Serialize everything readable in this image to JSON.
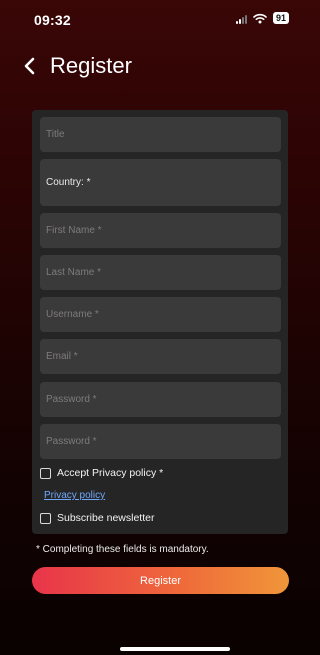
{
  "status": {
    "time": "09:32",
    "battery": "91"
  },
  "header": {
    "title": "Register"
  },
  "form": {
    "title_placeholder": "Title",
    "country_label": "Country: *",
    "first_name_placeholder": "First Name *",
    "last_name_placeholder": "Last Name *",
    "username_placeholder": "Username *",
    "email_placeholder": "Email *",
    "password_placeholder": "Password *",
    "password_confirm_placeholder": "Password *",
    "accept_privacy_label": "Accept Privacy policy *",
    "privacy_link": "Privacy policy",
    "subscribe_label": "Subscribe newsletter"
  },
  "footer": {
    "mandatory_note": "* Completing these fields is mandatory.",
    "register_button": "Register"
  },
  "colors": {
    "button_start": "#e8344a",
    "button_end": "#f0963a",
    "link": "#6fa8ff"
  }
}
